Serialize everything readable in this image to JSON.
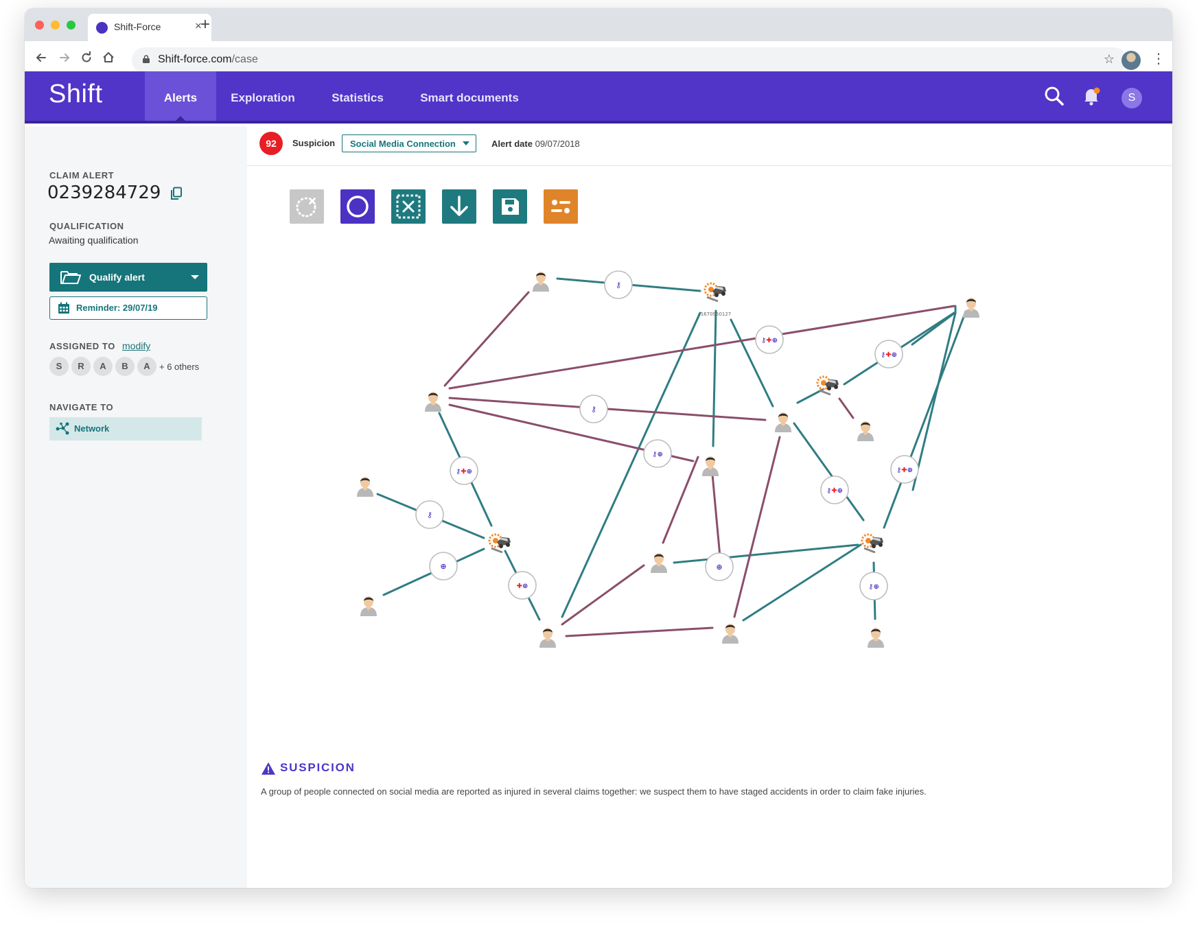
{
  "browser": {
    "tab_title": "Shift-Force",
    "url_host": "Shift-force.com",
    "url_path": "/case"
  },
  "app": {
    "logo": "Shift",
    "nav": [
      "Alerts",
      "Exploration",
      "Statistics",
      "Smart documents"
    ],
    "active_nav": "Alerts",
    "user_initial": "S"
  },
  "sidebar": {
    "claim_alert_label": "CLAIM ALERT",
    "claim_number": "0239284729",
    "qualification_label": "QUALIFICATION",
    "qualification_value": "Awaiting qualification",
    "qualify_button": "Qualify alert",
    "reminder_button": "Reminder: 29/07/19",
    "assigned_label": "ASSIGNED TO",
    "modify_link": "modify",
    "assignees": [
      "S",
      "R",
      "A",
      "B",
      "A"
    ],
    "others": "+ 6 others",
    "navigate_label": "NAVIGATE TO",
    "navigate_item": "Network"
  },
  "alert": {
    "score": "92",
    "suspicion_label": "Suspicion",
    "suspicion_value": "Social Media Connection",
    "date_label": "Alert date",
    "date_value": "09/07/2018"
  },
  "toolbar": {
    "tools": [
      "reset-layout-icon",
      "circle-select-icon",
      "box-select-icon",
      "download-icon",
      "save-icon",
      "filter-settings-icon"
    ],
    "colors": {
      "reset": "#c7c7c7",
      "circle": "#4b32c3",
      "box": "#1f7a7f",
      "download": "#1f7a7f",
      "save": "#1f7a7f",
      "filter": "#e0842a"
    }
  },
  "graph": {
    "node_label": "1670950127",
    "edge_colors": {
      "teal": "#2f7d83",
      "mauve": "#8a4e6a"
    }
  },
  "suspicion_panel": {
    "title": "SUSPICION",
    "description": "A group of people connected on social media are reported as injured in several claims together: we suspect them to have staged accidents in order to claim fake injuries."
  },
  "colors": {
    "brand": "#5035c8",
    "teal": "#16757a",
    "score_red": "#e81e25"
  }
}
